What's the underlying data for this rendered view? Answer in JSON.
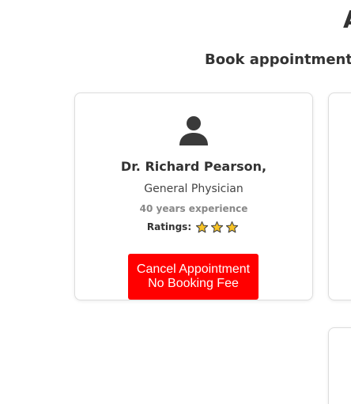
{
  "header": {
    "heading_fragment": "A",
    "subtitle": "Book appointments w"
  },
  "doctor_card": {
    "icon": "user-icon",
    "name": "Dr. Richard Pearson,",
    "specialty": "General Physician",
    "experience": "40 years experience",
    "ratings_label": "Ratings:",
    "rating": 3,
    "button_line1": "Cancel Appointment",
    "button_line2": "No Booking Fee",
    "colors": {
      "button_bg": "#ff0000",
      "button_text": "#ffffff",
      "star_fill": "#f7c325",
      "star_stroke": "#444444",
      "avatar": "#3a3a3a"
    }
  }
}
